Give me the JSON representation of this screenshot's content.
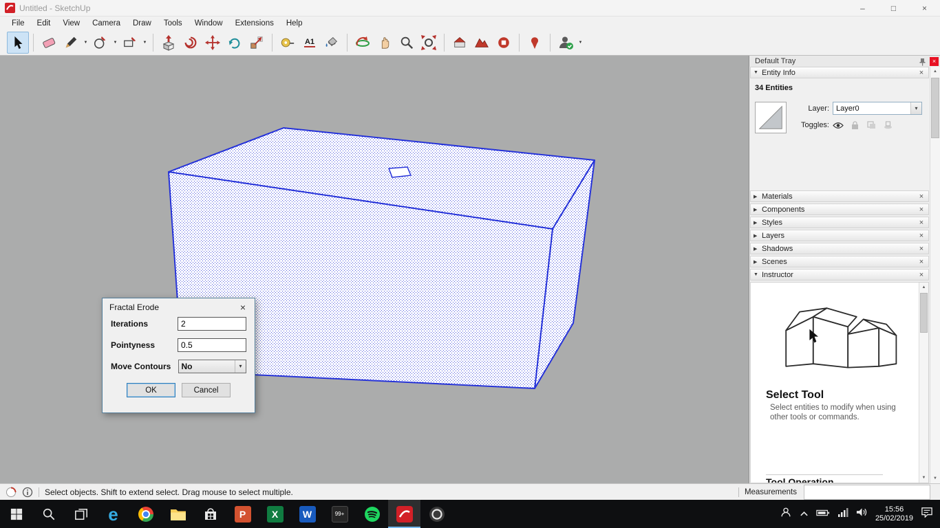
{
  "window": {
    "title": "Untitled - SketchUp"
  },
  "glyphs": {
    "minimize": "–",
    "maximize": "□",
    "close": "×",
    "expanded": "▼",
    "collapsed": "▶",
    "dropdown": "▼",
    "select_chevron": "▾",
    "scroll_up": "▲",
    "scroll_down": "▼"
  },
  "menu": {
    "items": [
      "File",
      "Edit",
      "View",
      "Camera",
      "Draw",
      "Tools",
      "Window",
      "Extensions",
      "Help"
    ]
  },
  "toolbar": {
    "text_tool_label": "A1"
  },
  "colors": {
    "selection_blue": "#2633d9",
    "canvas_gray": "#abacac",
    "tray_bg": "#f0f0f0",
    "taskbar_black": "#0e0f11",
    "active_tool_bg": "#cde3f6",
    "tray_close_red": "#e81123"
  },
  "dialog": {
    "title": "Fractal Erode",
    "fields": {
      "iterations": {
        "label": "Iterations",
        "value": "2"
      },
      "pointyness": {
        "label": "Pointyness",
        "value": "0.5"
      },
      "move_contours": {
        "label": "Move Contours",
        "value": "No"
      }
    },
    "buttons": {
      "ok": "OK",
      "cancel": "Cancel"
    }
  },
  "tray": {
    "title": "Default Tray",
    "entity_info": {
      "title": "Entity Info",
      "count": "34 Entities",
      "layer_label": "Layer:",
      "layer_value": "Layer0",
      "toggles_label": "Toggles:"
    },
    "sections": [
      "Materials",
      "Components",
      "Styles",
      "Layers",
      "Shadows",
      "Scenes"
    ],
    "instructor": {
      "title": "Instructor",
      "heading": "Select Tool",
      "body": "Select entities to modify when using other tools or commands.",
      "footer_heading": "Tool Operation"
    }
  },
  "statusbar": {
    "message": "Select objects. Shift to extend select. Drag mouse to select multiple.",
    "measurements_label": "Measurements"
  },
  "taskbar": {
    "badge": "99+",
    "edge_letter": "e",
    "powerpoint_letter": "P",
    "excel_letter": "X",
    "word_letter": "W",
    "time": "15:56",
    "date": "25/02/2019"
  }
}
